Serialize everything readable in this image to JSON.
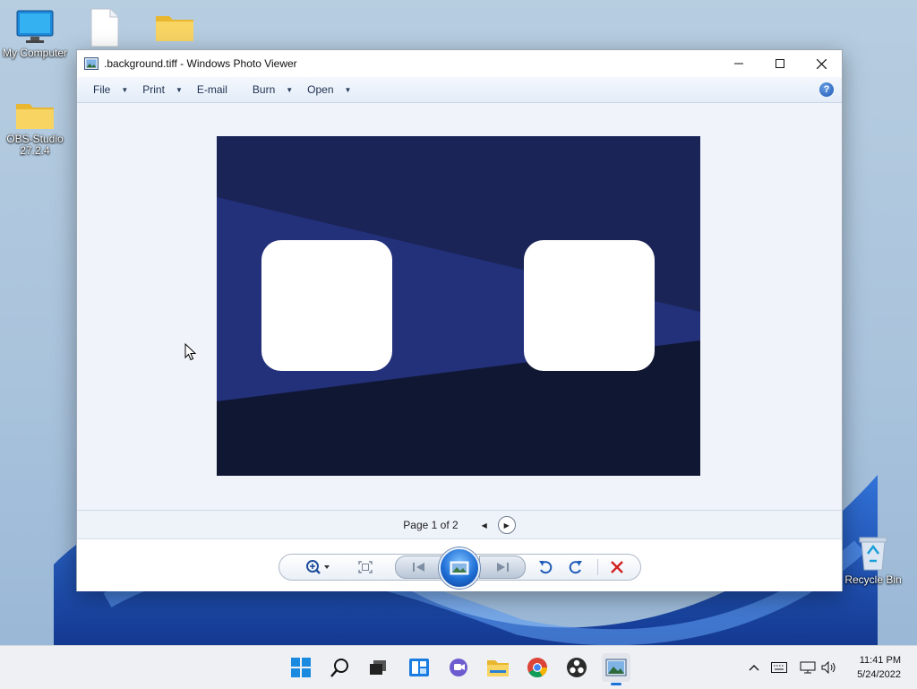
{
  "desktop": {
    "icons": [
      {
        "label": "My Computer",
        "icon": "monitor-icon"
      },
      {
        "label": "",
        "icon": "document-icon"
      },
      {
        "label": "",
        "icon": "folder-icon"
      },
      {
        "label": "OBS-Studio 27.2.4",
        "icon": "folder-icon"
      },
      {
        "label": "Recycle Bin",
        "icon": "recycle-bin-icon"
      }
    ]
  },
  "window": {
    "title": ".background.tiff - Windows Photo Viewer",
    "menu": {
      "file": "File",
      "print": "Print",
      "email": "E-mail",
      "burn": "Burn",
      "open": "Open"
    },
    "page_indicator": "Page 1 of 2"
  },
  "colors": {
    "photo_dark": "#1a2456",
    "photo_band": "#23307a",
    "photo_bottom": "#0f1733",
    "accent_blue": "#1b56b3",
    "delete_red": "#d02020"
  },
  "taskbar": {
    "apps": [
      "start-icon",
      "search-icon",
      "task-view-icon",
      "widgets-icon",
      "chat-icon",
      "file-explorer-icon",
      "chrome-icon",
      "obs-icon",
      "photo-viewer-icon"
    ],
    "time": "11:41 PM",
    "date": "5/24/2022"
  }
}
